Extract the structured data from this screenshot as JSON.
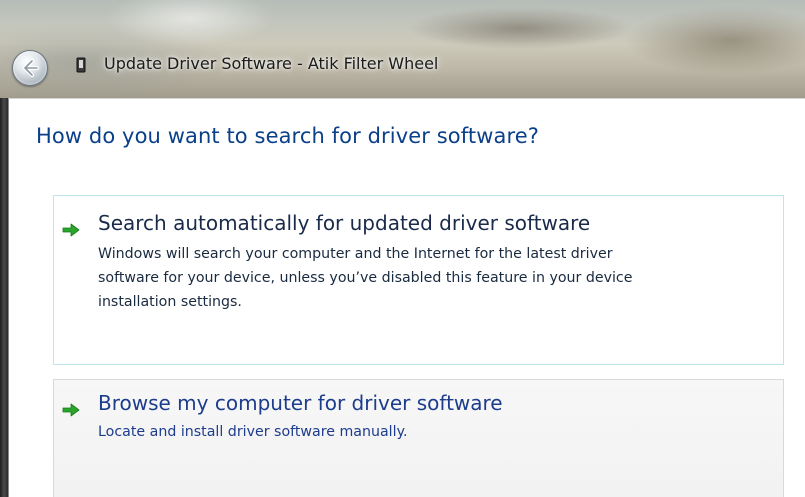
{
  "window": {
    "title": "Update Driver Software - Atik Filter Wheel"
  },
  "icons": {
    "back": "back-arrow-icon",
    "app": "device-icon",
    "option_arrow": "green-arrow-icon"
  },
  "colors": {
    "instruction": "#0a3f8a",
    "option_arrow": "#2aa52a",
    "link_blue": "#1c3c8c"
  },
  "main": {
    "instruction": "How do you want to search for driver software?",
    "options": [
      {
        "title": "Search automatically for updated driver software",
        "description_lines": [
          "Windows will search your computer and the Internet for the latest driver",
          "software for your device, unless you’ve disabled this feature in your device",
          "installation settings."
        ]
      },
      {
        "title": "Browse my computer for driver software",
        "description_lines": [
          "Locate and install driver software manually."
        ]
      }
    ]
  }
}
